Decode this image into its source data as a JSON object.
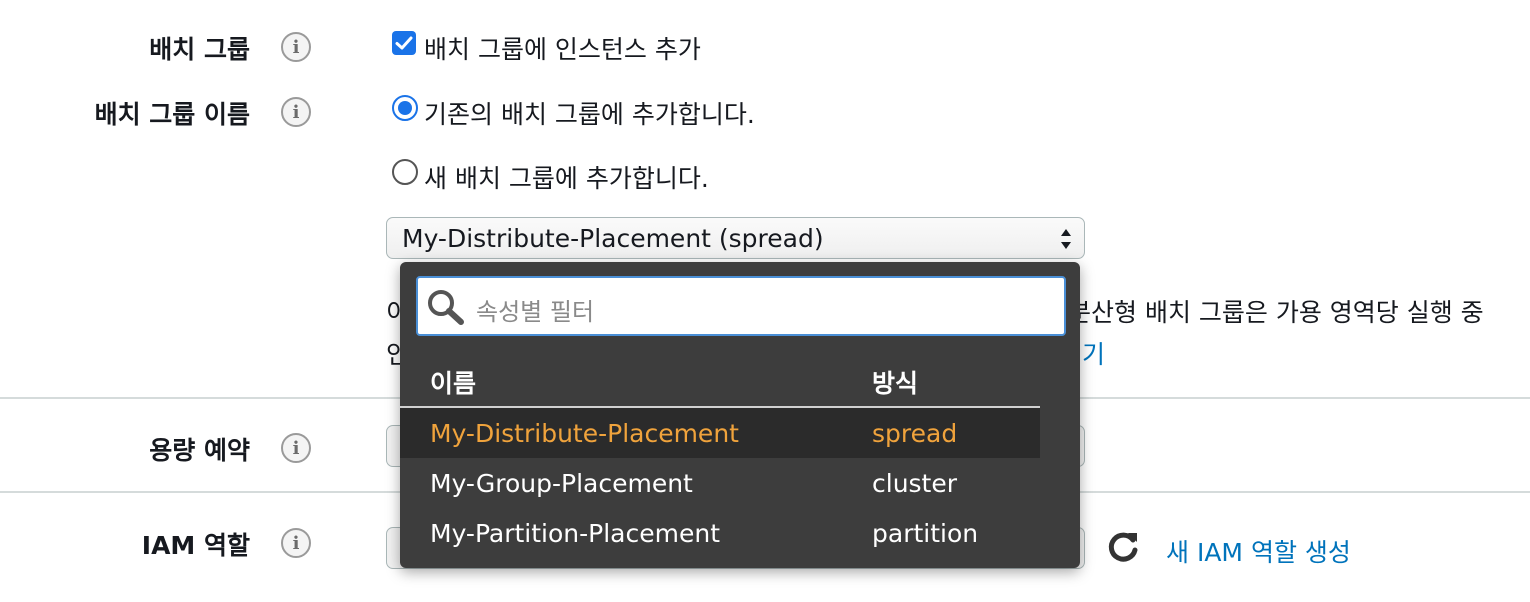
{
  "rows": {
    "placement_group": {
      "label": "배치 그룹",
      "checkbox_label": "배치 그룹에 인스턴스 추가",
      "checked": true
    },
    "placement_group_name": {
      "label": "배치 그룹 이름",
      "options": [
        "기존의 배치 그룹에 추가합니다.",
        "새 배치 그룹에 추가합니다."
      ],
      "selected_index": 0
    },
    "select": {
      "value": "My-Distribute-Placement (spread)"
    },
    "help": {
      "line1_start": "이",
      "line1_end": "분산형 배치 그룹은 가용 영역당 실행 중",
      "line2_start": "인",
      "line2_link": "기"
    },
    "capacity_reservation": {
      "label": "용량 예약"
    },
    "iam_role": {
      "label": "IAM 역할",
      "create_link": "새 IAM 역할 생성"
    }
  },
  "dropdown": {
    "filter_placeholder": "속성별 필터",
    "columns": [
      "이름",
      "방식"
    ],
    "items": [
      {
        "name": "My-Distribute-Placement",
        "strategy": "spread",
        "selected": true
      },
      {
        "name": "My-Group-Placement",
        "strategy": "cluster",
        "selected": false
      },
      {
        "name": "My-Partition-Placement",
        "strategy": "partition",
        "selected": false
      }
    ]
  },
  "colors": {
    "accent": "#1a73e8",
    "link": "#0073bb",
    "selected_item": "#f0a33c",
    "dropdown_bg": "#3d3d3d"
  },
  "icons": [
    "info-icon",
    "checkbox-checked-icon",
    "select-arrows-icon",
    "search-icon",
    "refresh-icon"
  ]
}
